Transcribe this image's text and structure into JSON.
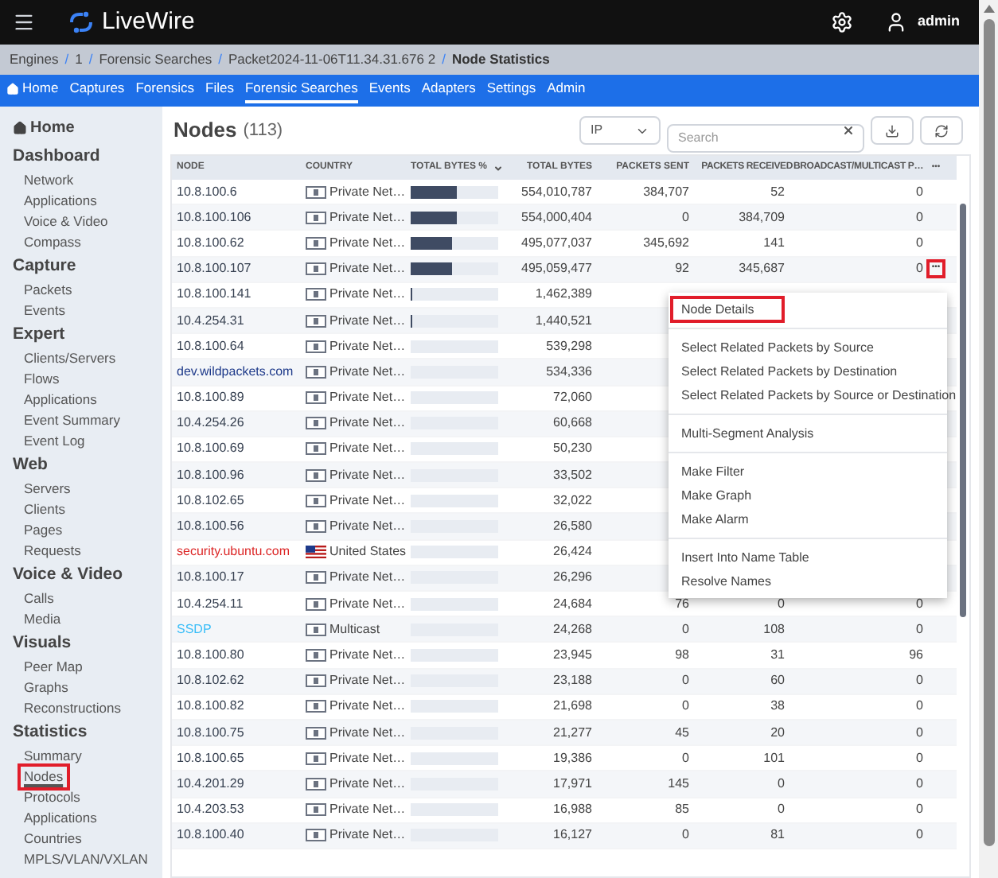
{
  "app": {
    "name": "LiveWire",
    "user": "admin"
  },
  "breadcrumbs": [
    {
      "label": "Engines"
    },
    {
      "separator": "/",
      "label": "1"
    },
    {
      "separator": "/",
      "label": "Forensic Searches"
    },
    {
      "separator": "/",
      "label": "Packet2024-11-06T11.34.31.676 2"
    },
    {
      "separator": "/",
      "label": "Node Statistics"
    }
  ],
  "nav": [
    {
      "label": "Home",
      "selected": false
    },
    {
      "label": "Captures",
      "selected": false
    },
    {
      "label": "Forensics",
      "selected": false
    },
    {
      "label": "Files",
      "selected": false
    },
    {
      "label": "Forensic Searches",
      "selected": true
    },
    {
      "label": "Events",
      "selected": false
    },
    {
      "label": "Adapters",
      "selected": false
    },
    {
      "label": "Settings",
      "selected": false
    },
    {
      "label": "Admin",
      "selected": false
    }
  ],
  "sidebar": {
    "home": "Home",
    "sections": [
      {
        "title": "Dashboard",
        "items": [
          {
            "label": "Network",
            "selected": false,
            "outlined": false
          },
          {
            "label": "Applications",
            "selected": false,
            "outlined": false
          },
          {
            "label": "Voice & Video",
            "selected": false,
            "outlined": false
          },
          {
            "label": "Compass",
            "selected": false,
            "outlined": false
          }
        ]
      },
      {
        "title": "Capture",
        "items": [
          {
            "label": "Packets",
            "selected": false,
            "outlined": false
          },
          {
            "label": "Events",
            "selected": false,
            "outlined": false
          }
        ]
      },
      {
        "title": "Expert",
        "items": [
          {
            "label": "Clients/Servers",
            "selected": false,
            "outlined": false
          },
          {
            "label": "Flows",
            "selected": false,
            "outlined": false
          },
          {
            "label": "Applications",
            "selected": false,
            "outlined": false
          },
          {
            "label": "Event Summary",
            "selected": false,
            "outlined": false
          },
          {
            "label": "Event Log",
            "selected": false,
            "outlined": false
          }
        ]
      },
      {
        "title": "Web",
        "items": [
          {
            "label": "Servers",
            "selected": false,
            "outlined": false
          },
          {
            "label": "Clients",
            "selected": false,
            "outlined": false
          },
          {
            "label": "Pages",
            "selected": false,
            "outlined": false
          },
          {
            "label": "Requests",
            "selected": false,
            "outlined": false
          }
        ]
      },
      {
        "title": "Voice & Video",
        "items": [
          {
            "label": "Calls",
            "selected": false,
            "outlined": false
          },
          {
            "label": "Media",
            "selected": false,
            "outlined": false
          }
        ]
      },
      {
        "title": "Visuals",
        "items": [
          {
            "label": "Peer Map",
            "selected": false,
            "outlined": false
          },
          {
            "label": "Graphs",
            "selected": false,
            "outlined": false
          },
          {
            "label": "Reconstructions",
            "selected": false,
            "outlined": false
          }
        ]
      },
      {
        "title": "Statistics",
        "items": [
          {
            "label": "Summary",
            "selected": false,
            "outlined": false
          },
          {
            "label": "Nodes",
            "selected": true,
            "outlined": true
          },
          {
            "label": "Protocols",
            "selected": false,
            "outlined": false
          },
          {
            "label": "Applications",
            "selected": false,
            "outlined": false
          },
          {
            "label": "Countries",
            "selected": false,
            "outlined": false
          },
          {
            "label": "MPLS/VLAN/VXLAN",
            "selected": false,
            "outlined": false
          }
        ]
      }
    ]
  },
  "page": {
    "title": "Nodes",
    "count": "(113)",
    "filter": "IP",
    "search_placeholder": "Search"
  },
  "table": {
    "columns": [
      "NODE",
      "COUNTRY",
      "TOTAL BYTES %",
      "TOTAL BYTES",
      "PACKETS SENT",
      "PACKETS RECEIVED",
      "BROADCAST/MULTICAST P…"
    ],
    "more": "•••",
    "rows": [
      {
        "node": "10.8.100.6",
        "color": "#374151",
        "kind": "private",
        "country": "Private Net…",
        "level": 0.52,
        "bytes": "554,010,787",
        "sent": "384,707",
        "received": "52",
        "bcast": "0",
        "menu_button": false
      },
      {
        "node": "10.8.100.106",
        "color": "#374151",
        "kind": "private",
        "country": "Private Net…",
        "level": 0.52,
        "bytes": "554,000,404",
        "sent": "0",
        "received": "384,709",
        "bcast": "0",
        "menu_button": false
      },
      {
        "node": "10.8.100.62",
        "color": "#374151",
        "kind": "private",
        "country": "Private Net…",
        "level": 0.47,
        "bytes": "495,077,037",
        "sent": "345,692",
        "received": "141",
        "bcast": "0",
        "menu_button": false
      },
      {
        "node": "10.8.100.107",
        "color": "#374151",
        "kind": "private",
        "country": "Private Net…",
        "level": 0.47,
        "bytes": "495,059,477",
        "sent": "92",
        "received": "345,687",
        "bcast": "0",
        "menu_button": true
      },
      {
        "node": "10.8.100.141",
        "color": "#374151",
        "kind": "private",
        "country": "Private Net…",
        "level": 0.01,
        "bytes": "1,462,389",
        "menu_button": false
      },
      {
        "node": "10.4.254.31",
        "color": "#374151",
        "kind": "private",
        "country": "Private Net…",
        "level": 0.01,
        "bytes": "1,440,521",
        "menu_button": false
      },
      {
        "node": "10.8.100.64",
        "color": "#374151",
        "kind": "private",
        "country": "Private Net…",
        "bytes": "539,298",
        "menu_button": false
      },
      {
        "node": "dev.wildpackets.com",
        "color": "#1e3a8a",
        "kind": "private",
        "country": "Private Net…",
        "bytes": "534,336",
        "menu_button": false
      },
      {
        "node": "10.8.100.89",
        "color": "#374151",
        "kind": "private",
        "country": "Private Net…",
        "bytes": "72,060",
        "menu_button": false
      },
      {
        "node": "10.4.254.26",
        "color": "#374151",
        "kind": "private",
        "country": "Private Net…",
        "bytes": "60,668",
        "menu_button": false
      },
      {
        "node": "10.8.100.69",
        "color": "#374151",
        "kind": "private",
        "country": "Private Net…",
        "bytes": "50,230",
        "menu_button": false
      },
      {
        "node": "10.8.100.96",
        "color": "#374151",
        "kind": "private",
        "country": "Private Net…",
        "bytes": "33,502",
        "menu_button": false
      },
      {
        "node": "10.8.102.65",
        "color": "#374151",
        "kind": "private",
        "country": "Private Net…",
        "bytes": "32,022",
        "menu_button": false
      },
      {
        "node": "10.8.100.56",
        "color": "#374151",
        "kind": "private",
        "country": "Private Net…",
        "bytes": "26,580",
        "menu_button": false
      },
      {
        "node": "security.ubuntu.com",
        "color": "#dc2626",
        "kind": "us",
        "country": "United States",
        "bytes": "26,424",
        "menu_button": false
      },
      {
        "node": "10.8.100.17",
        "color": "#374151",
        "kind": "private",
        "country": "Private Net…",
        "bytes": "26,296",
        "menu_button": false
      },
      {
        "node": "10.4.254.11",
        "color": "#374151",
        "kind": "private",
        "country": "Private Net…",
        "bytes": "24,684",
        "sent": "76",
        "received": "0",
        "bcast": "0",
        "menu_button": false
      },
      {
        "node": "SSDP",
        "color": "#38bdf8",
        "kind": "private",
        "country": "Multicast",
        "bytes": "24,268",
        "sent": "0",
        "received": "108",
        "bcast": "0",
        "menu_button": false
      },
      {
        "node": "10.8.100.80",
        "color": "#374151",
        "kind": "private",
        "country": "Private Net…",
        "bytes": "23,945",
        "sent": "98",
        "received": "31",
        "bcast": "96",
        "menu_button": false
      },
      {
        "node": "10.8.102.62",
        "color": "#374151",
        "kind": "private",
        "country": "Private Net…",
        "bytes": "23,188",
        "sent": "0",
        "received": "60",
        "bcast": "0",
        "menu_button": false
      },
      {
        "node": "10.8.100.82",
        "color": "#374151",
        "kind": "private",
        "country": "Private Net…",
        "bytes": "21,698",
        "sent": "0",
        "received": "38",
        "bcast": "0",
        "menu_button": false
      },
      {
        "node": "10.8.100.75",
        "color": "#374151",
        "kind": "private",
        "country": "Private Net…",
        "bytes": "21,277",
        "sent": "45",
        "received": "20",
        "bcast": "0",
        "menu_button": false
      },
      {
        "node": "10.8.100.65",
        "color": "#374151",
        "kind": "private",
        "country": "Private Net…",
        "bytes": "19,386",
        "sent": "0",
        "received": "101",
        "bcast": "0",
        "menu_button": false
      },
      {
        "node": "10.4.201.29",
        "color": "#374151",
        "kind": "private",
        "country": "Private Net…",
        "bytes": "17,971",
        "sent": "145",
        "received": "0",
        "bcast": "0",
        "menu_button": false
      },
      {
        "node": "10.4.203.53",
        "color": "#374151",
        "kind": "private",
        "country": "Private Net…",
        "bytes": "16,988",
        "sent": "85",
        "received": "0",
        "bcast": "0",
        "menu_button": false
      },
      {
        "node": "10.8.100.40",
        "color": "#374151",
        "kind": "private",
        "country": "Private Net…",
        "bytes": "16,127",
        "sent": "0",
        "received": "81",
        "bcast": "0",
        "menu_button": false
      }
    ]
  },
  "context_menu": [
    {
      "label": "Node Details",
      "outlined": true,
      "divider_after": true
    },
    {
      "label": "Select Related Packets by Source",
      "outlined": false,
      "divider_after": false
    },
    {
      "label": "Select Related Packets by Destination",
      "outlined": false,
      "divider_after": false
    },
    {
      "label": "Select Related Packets by Source or Destination",
      "outlined": false,
      "divider_after": true
    },
    {
      "label": "Multi-Segment Analysis",
      "outlined": false,
      "divider_after": true
    },
    {
      "label": "Make Filter",
      "outlined": false,
      "divider_after": false
    },
    {
      "label": "Make Graph",
      "outlined": false,
      "divider_after": false
    },
    {
      "label": "Make Alarm",
      "outlined": false,
      "divider_after": true
    },
    {
      "label": "Insert Into Name Table",
      "outlined": false,
      "divider_after": false
    },
    {
      "label": "Resolve Names",
      "outlined": false,
      "divider_after": false
    }
  ]
}
